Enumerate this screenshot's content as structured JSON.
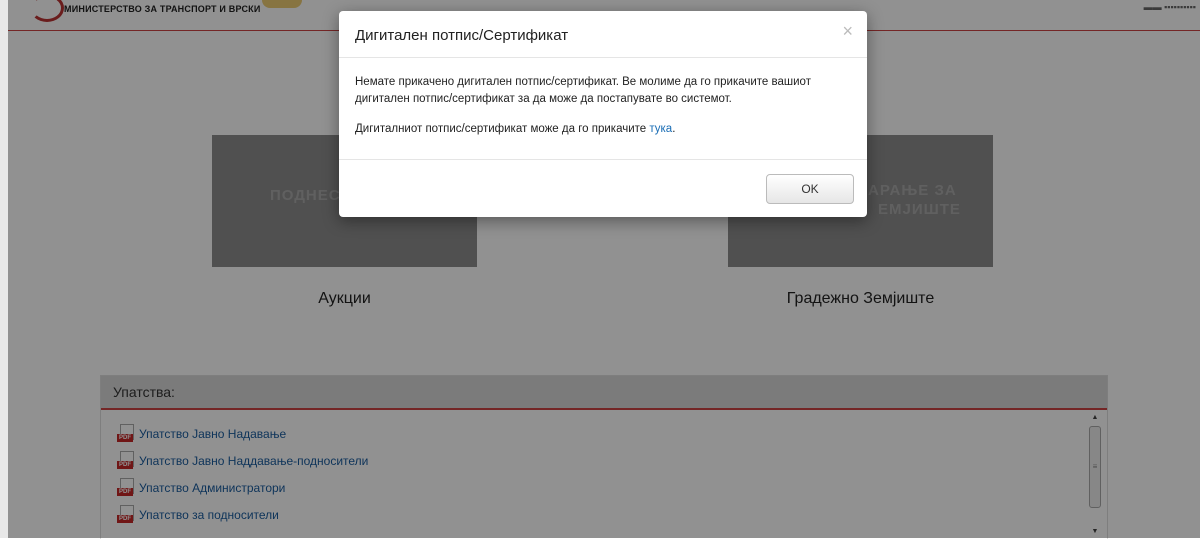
{
  "header": {
    "ministry_name": "МИНИСТЕРСТВО ЗА ТРАНСПОРТ И ВРСКИ"
  },
  "tiles": [
    {
      "label": "ПОДНЕСИ",
      "caption": "Аукции"
    },
    {
      "label_line1": "АРАЊЕ ЗА",
      "label_line2": "ЕМЈИШТЕ",
      "caption": "Градежно Земјиште"
    }
  ],
  "guides": {
    "title": "Упатства:",
    "items": [
      "Упатство Јавно Надавање",
      "Упатство Јавно Наддавање-подносители",
      "Упатство Администратори",
      "Упатство за подносители"
    ]
  },
  "modal": {
    "title": "Дигитален потпис/Сертификат",
    "close": "×",
    "body_line1": "Немате прикачено дигитален потпис/сертификат. Ве молиме да го прикачите вашиот",
    "body_line2": "дигитален потпис/сертификат за да може да постапувате во системот.",
    "body_p2_prefix": "Дигиталниот потпис/сертификат може да го прикачите ",
    "body_p2_link": "тука",
    "body_p2_suffix": ".",
    "ok_label": "OK"
  }
}
